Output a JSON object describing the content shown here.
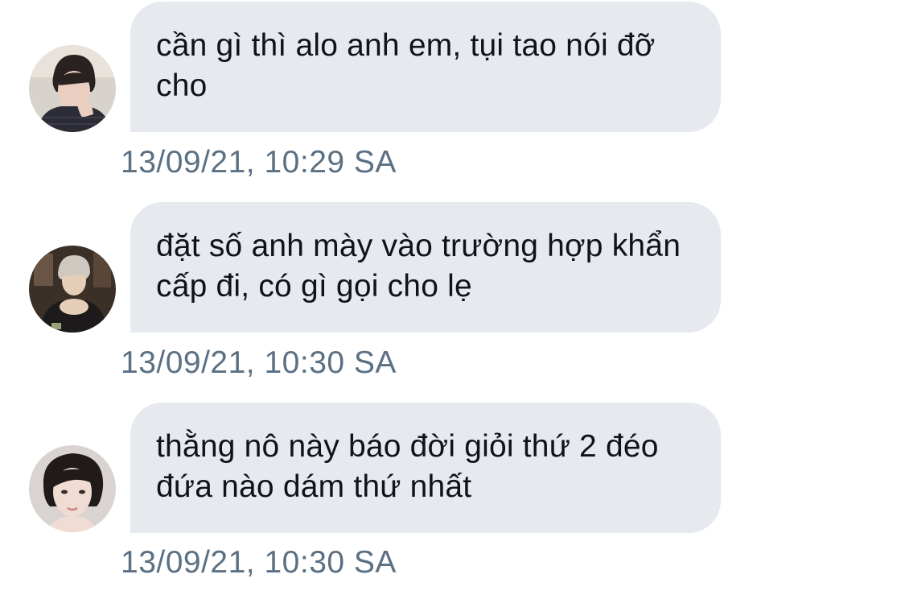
{
  "conversation": {
    "messages": [
      {
        "text": "cần gì thì alo anh em, tụi tao nói đỡ cho",
        "timestamp": "13/09/21, 10:29 SA",
        "avatar_icon": "profile-photo-hand-on-face"
      },
      {
        "text": "đặt số anh mày vào trường hợp khẩn cấp đi, có gì gọi cho lẹ",
        "timestamp": "13/09/21, 10:30 SA",
        "avatar_icon": "profile-photo-hands-clasped"
      },
      {
        "text": "thằng nô này báo đời giỏi thứ 2 đéo đứa nào dám thứ nhất",
        "timestamp": "13/09/21, 10:30 SA",
        "avatar_icon": "profile-photo-portrait"
      }
    ]
  },
  "colors": {
    "bubble_bg": "#e6eaef",
    "message_text": "#0f1419",
    "timestamp_text": "#5b7083",
    "page_bg": "#ffffff"
  }
}
